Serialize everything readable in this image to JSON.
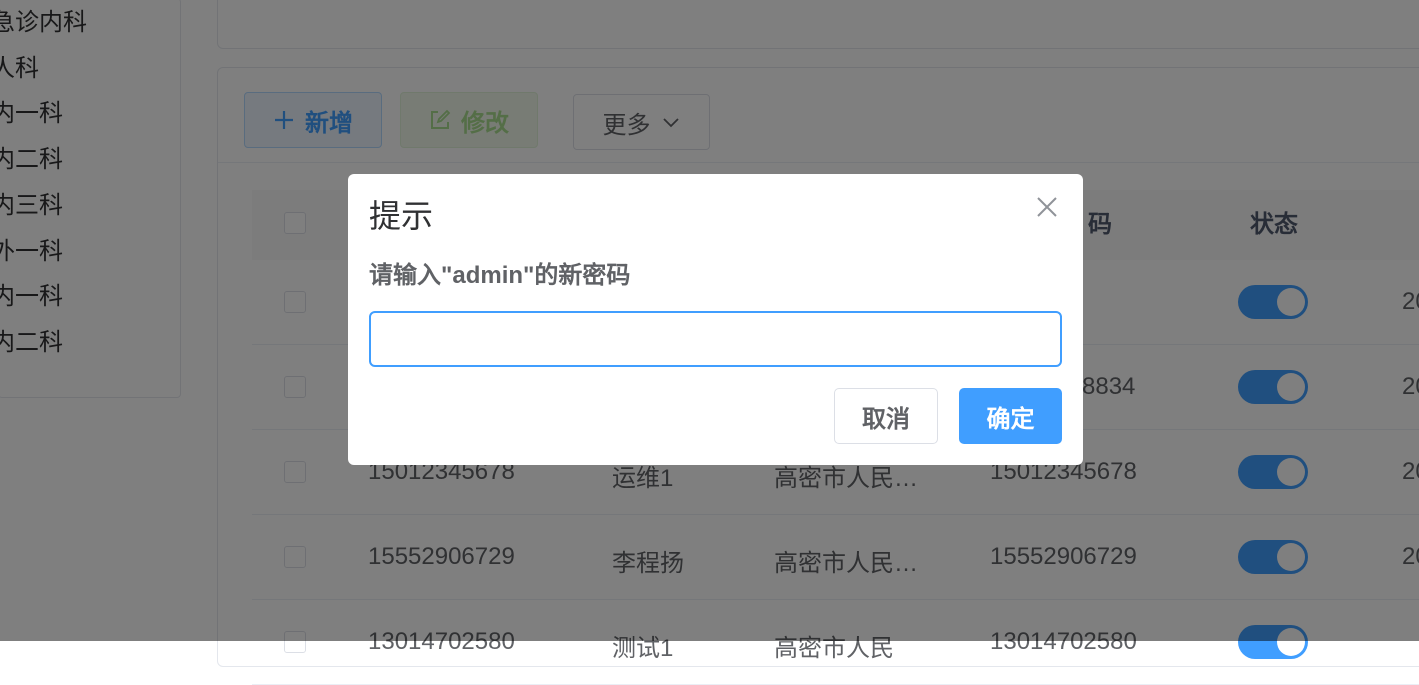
{
  "tree": {
    "items": [
      "急诊内科",
      "人科",
      "内一科",
      "内二科",
      "内三科",
      "外一科",
      "内一科",
      "内二科"
    ]
  },
  "toolbar": {
    "add_label": "新增",
    "add_icon": "plus-icon",
    "edit_label": "修改",
    "edit_icon": "edit-icon",
    "more_label": "更多",
    "more_icon": "chevron-down-icon"
  },
  "table": {
    "headers": {
      "phone_partial": "码",
      "status": "状态"
    },
    "rows": [
      {
        "account": "",
        "name": "",
        "dept": "",
        "phone": "",
        "status_on": true,
        "created_partial": "20"
      },
      {
        "account": "",
        "name": "",
        "dept": "",
        "phone": "8834",
        "status_on": true,
        "created_partial": "20"
      },
      {
        "account": "15012345678",
        "name": "运维1",
        "dept": "高密市人民…",
        "phone": "15012345678",
        "status_on": true,
        "created_partial": "20"
      },
      {
        "account": "15552906729",
        "name": "李程扬",
        "dept": "高密市人民…",
        "phone": "15552906729",
        "status_on": true,
        "created_partial": "20"
      },
      {
        "account": "13014702580",
        "name": "测试1",
        "dept": "高密市人民",
        "phone": "13014702580",
        "status_on": true,
        "created_partial": ""
      }
    ]
  },
  "dialog": {
    "title": "提示",
    "message": "请输入\"admin\"的新密码",
    "input_value": "",
    "cancel_label": "取消",
    "confirm_label": "确定",
    "close_icon": "close-icon"
  },
  "colors": {
    "primary": "#409eff",
    "success_light": "#f0f9eb",
    "overlay": "rgba(0,0,0,0.5)"
  }
}
